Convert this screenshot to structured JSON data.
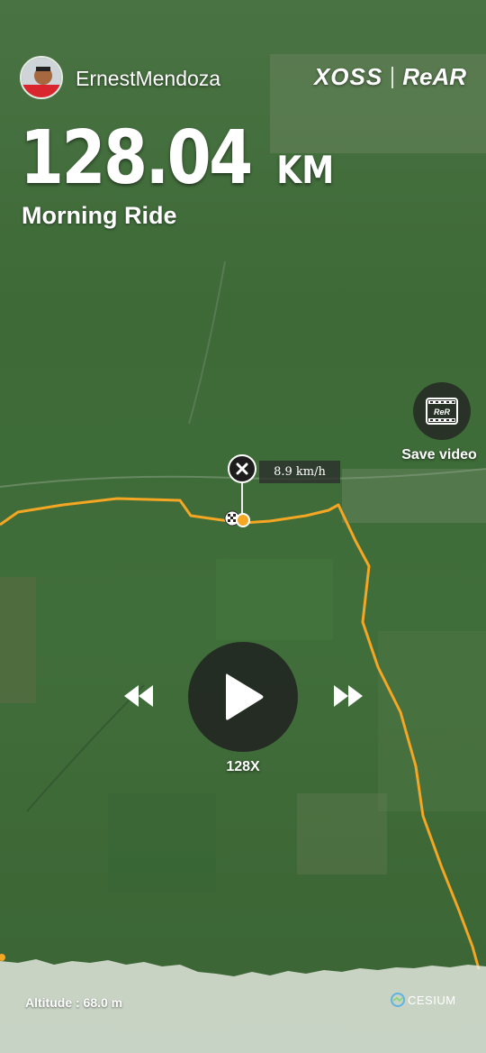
{
  "user": {
    "name": "ErnestMendoza"
  },
  "brand": {
    "primary": "XOSS",
    "secondary": "ReAR"
  },
  "ride": {
    "distance": "128.04",
    "unit": "KM",
    "name": "Morning Ride"
  },
  "actions": {
    "save_video": "Save video",
    "save_video_icon_text": "ReR"
  },
  "marker": {
    "speed": "8.9 km/h"
  },
  "playback": {
    "multiplier": "128X"
  },
  "footer": {
    "altitude": "Altitude : 68.0 m",
    "map_credit": "CESIUM"
  },
  "colors": {
    "route": "#f5a623",
    "map": "#3f6a37",
    "control_bg": "#1e1e1e"
  },
  "icons": [
    "close-icon",
    "play-icon",
    "rewind-icon",
    "fast-forward-icon",
    "film-icon",
    "finish-flag-icon",
    "position-dot-icon",
    "cesium-logo-icon"
  ]
}
